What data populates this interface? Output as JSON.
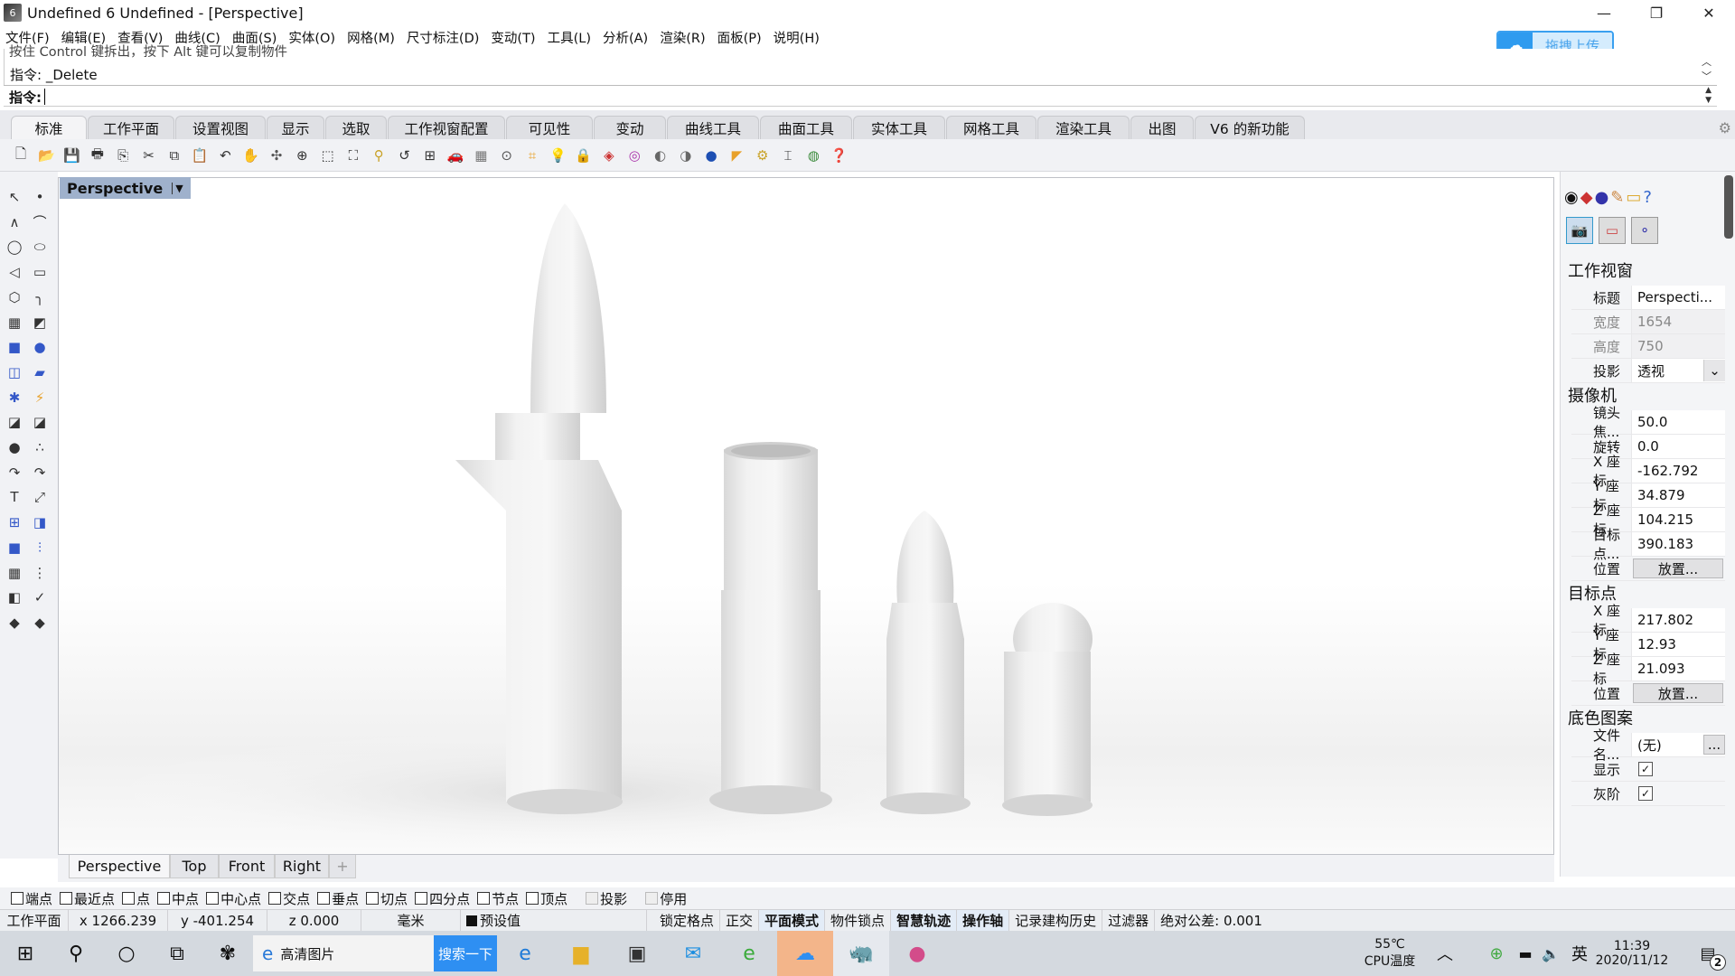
{
  "window": {
    "title": "Undefined 6 Undefined - [Perspective]",
    "controls": {
      "minimize": "—",
      "restore": "❐",
      "close": "✕"
    }
  },
  "menu": [
    "文件(F)",
    "编辑(E)",
    "查看(V)",
    "曲线(C)",
    "曲面(S)",
    "实体(O)",
    "网格(M)",
    "尺寸标注(D)",
    "变动(T)",
    "工具(L)",
    "分析(A)",
    "渲染(R)",
    "面板(P)",
    "说明(H)"
  ],
  "upload_button": {
    "label": "拖拽上传"
  },
  "command": {
    "history_line1": "按住 Control 键拆出，按下 Alt 键可以复制物件",
    "history_line2": "指令: _Delete",
    "prompt": "指令:",
    "value": ""
  },
  "toolbar_tabs": [
    {
      "label": "标准",
      "active": true
    },
    {
      "label": "工作平面"
    },
    {
      "label": "设置视图"
    },
    {
      "label": "显示"
    },
    {
      "label": "选取"
    },
    {
      "label": "工作视窗配置"
    },
    {
      "label": "可见性"
    },
    {
      "label": "变动"
    },
    {
      "label": "曲线工具"
    },
    {
      "label": "曲面工具"
    },
    {
      "label": "实体工具"
    },
    {
      "label": "网格工具"
    },
    {
      "label": "渲染工具"
    },
    {
      "label": "出图"
    },
    {
      "label": "V6 的新功能"
    }
  ],
  "toolbar_icons": [
    "new-file",
    "open-folder",
    "save",
    "print",
    "import",
    "cut",
    "copy",
    "paste",
    "undo",
    "pan-hand",
    "rotate-view",
    "zoom-in",
    "zoom-window",
    "zoom-extents",
    "zoom-selected",
    "undo-view",
    "four-viewports",
    "car-named-view",
    "grid",
    "cplane",
    "set-cplane",
    "light-bulb",
    "lock",
    "shaded",
    "color-wheel",
    "render-sphere",
    "render-ghost",
    "blue-sphere",
    "dimension",
    "settings-gear",
    "dimension-tool",
    "globe",
    "help"
  ],
  "viewport": {
    "title": "Perspective",
    "tabs": [
      "Perspective",
      "Top",
      "Front",
      "Right"
    ],
    "add_tab": "+"
  },
  "properties": {
    "section_viewport": "工作视窗",
    "viewport_rows": [
      {
        "key": "标题",
        "value": "Perspecti..."
      },
      {
        "key": "宽度",
        "value": "1654",
        "dim": true
      },
      {
        "key": "高度",
        "value": "750",
        "dim": true
      },
      {
        "key": "投影",
        "value": "透视"
      }
    ],
    "section_camera": "摄像机",
    "camera_rows": [
      {
        "key": "镜头焦...",
        "value": "50.0"
      },
      {
        "key": "旋转",
        "value": "0.0"
      },
      {
        "key": "X 座标",
        "value": "-162.792"
      },
      {
        "key": "Y 座标",
        "value": "34.879"
      },
      {
        "key": "Z 座标",
        "value": "104.215"
      },
      {
        "key": "目标点...",
        "value": "390.183"
      },
      {
        "key": "位置",
        "button": "放置..."
      }
    ],
    "section_target": "目标点",
    "target_rows": [
      {
        "key": "X 座标",
        "value": "217.802"
      },
      {
        "key": "Y 座标",
        "value": "12.93"
      },
      {
        "key": "Z 座标",
        "value": "21.093"
      },
      {
        "key": "位置",
        "button": "放置..."
      }
    ],
    "section_wallpaper": "底色图案",
    "wallpaper_rows": [
      {
        "key": "文件名...",
        "value": "(无)",
        "button": "..."
      },
      {
        "key": "显示",
        "checked": true
      },
      {
        "key": "灰阶",
        "checked": true
      }
    ]
  },
  "osnap": [
    {
      "label": "端点",
      "checked": false
    },
    {
      "label": "最近点",
      "checked": false
    },
    {
      "label": "点",
      "checked": false
    },
    {
      "label": "中点",
      "checked": false
    },
    {
      "label": "中心点",
      "checked": false
    },
    {
      "label": "交点",
      "checked": false
    },
    {
      "label": "垂点",
      "checked": false
    },
    {
      "label": "切点",
      "checked": false
    },
    {
      "label": "四分点",
      "checked": false
    },
    {
      "label": "节点",
      "checked": false
    },
    {
      "label": "顶点",
      "checked": false
    },
    {
      "label": "投影",
      "checked": false,
      "disabled": true
    },
    {
      "label": "停用",
      "checked": false,
      "disabled": true
    }
  ],
  "status": {
    "cplane": "工作平面",
    "x": "x 1266.239",
    "y": "y -401.254",
    "z": "z 0.000",
    "units": "毫米",
    "layer": "预设值",
    "toggles": [
      {
        "label": "锁定格点",
        "bold": false
      },
      {
        "label": "正交",
        "bold": false
      },
      {
        "label": "平面模式",
        "bold": true
      },
      {
        "label": "物件锁点",
        "bold": false
      },
      {
        "label": "智慧轨迹",
        "bold": true
      },
      {
        "label": "操作轴",
        "bold": true
      },
      {
        "label": "记录建构历史",
        "bold": false
      },
      {
        "label": "过滤器",
        "bold": false
      }
    ],
    "tolerance": "绝对公差: 0.001"
  },
  "taskbar": {
    "search_text": "高清图片",
    "search_button": "搜索一下",
    "cpu_temp": "55℃",
    "cpu_label": "CPU温度",
    "ime": "英",
    "time": "11:39",
    "date": "2020/11/12",
    "notifications": "2"
  }
}
